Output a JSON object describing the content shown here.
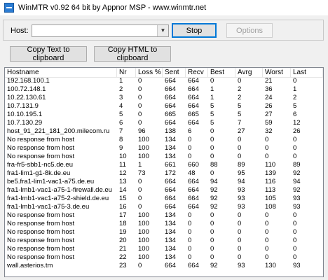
{
  "window": {
    "title": "WinMTR v0.92 64 bit by Appnor MSP - www.winmtr.net"
  },
  "toolbar": {
    "host_label": "Host:",
    "host_value": "",
    "stop_label": "Stop",
    "options_label": "Options",
    "copy_text_label": "Copy Text to clipboard",
    "copy_html_label": "Copy HTML to clipboard"
  },
  "table": {
    "columns": [
      "Hostname",
      "Nr",
      "Loss %",
      "Sent",
      "Recv",
      "Best",
      "Avrg",
      "Worst",
      "Last"
    ],
    "rows": [
      [
        "192.168.100.1",
        "1",
        "0",
        "664",
        "664",
        "0",
        "0",
        "21",
        "0"
      ],
      [
        "100.72.148.1",
        "2",
        "0",
        "664",
        "664",
        "1",
        "2",
        "36",
        "1"
      ],
      [
        "10.22.130.61",
        "3",
        "0",
        "664",
        "664",
        "1",
        "2",
        "24",
        "2"
      ],
      [
        "10.7.131.9",
        "4",
        "0",
        "664",
        "664",
        "5",
        "5",
        "26",
        "5"
      ],
      [
        "10.10.195.1",
        "5",
        "0",
        "665",
        "665",
        "5",
        "5",
        "27",
        "6"
      ],
      [
        "10.7.130.29",
        "6",
        "0",
        "664",
        "664",
        "5",
        "7",
        "59",
        "12"
      ],
      [
        "host_91_221_181_200.milecom.ru",
        "7",
        "96",
        "138",
        "6",
        "0",
        "27",
        "32",
        "26"
      ],
      [
        "No response from host",
        "8",
        "100",
        "134",
        "0",
        "0",
        "0",
        "0",
        "0"
      ],
      [
        "No response from host",
        "9",
        "100",
        "134",
        "0",
        "0",
        "0",
        "0",
        "0"
      ],
      [
        "No response from host",
        "10",
        "100",
        "134",
        "0",
        "0",
        "0",
        "0",
        "0"
      ],
      [
        "fra-fr5-sbb1-nc5.de.eu",
        "11",
        "1",
        "661",
        "660",
        "88",
        "89",
        "110",
        "89"
      ],
      [
        "fra1-lim1-g1-8k.de.eu",
        "12",
        "73",
        "172",
        "48",
        "0",
        "95",
        "139",
        "92"
      ],
      [
        "be5.fra1-lim1-vac1-a75.de.eu",
        "13",
        "0",
        "664",
        "664",
        "94",
        "94",
        "116",
        "94"
      ],
      [
        "fra1-lmb1-vac1-a75-1-firewall.de.eu",
        "14",
        "0",
        "664",
        "664",
        "92",
        "93",
        "113",
        "92"
      ],
      [
        "fra1-lmb1-vac1-a75-2-shield.de.eu",
        "15",
        "0",
        "664",
        "664",
        "92",
        "93",
        "105",
        "93"
      ],
      [
        "fra1-lmb1-vac1-a75-3.de.eu",
        "16",
        "0",
        "664",
        "664",
        "92",
        "93",
        "108",
        "93"
      ],
      [
        "No response from host",
        "17",
        "100",
        "134",
        "0",
        "0",
        "0",
        "0",
        "0"
      ],
      [
        "No response from host",
        "18",
        "100",
        "134",
        "0",
        "0",
        "0",
        "0",
        "0"
      ],
      [
        "No response from host",
        "19",
        "100",
        "134",
        "0",
        "0",
        "0",
        "0",
        "0"
      ],
      [
        "No response from host",
        "20",
        "100",
        "134",
        "0",
        "0",
        "0",
        "0",
        "0"
      ],
      [
        "No response from host",
        "21",
        "100",
        "134",
        "0",
        "0",
        "0",
        "0",
        "0"
      ],
      [
        "No response from host",
        "22",
        "100",
        "134",
        "0",
        "0",
        "0",
        "0",
        "0"
      ],
      [
        "wall.asterios.tm",
        "23",
        "0",
        "664",
        "664",
        "92",
        "93",
        "130",
        "93"
      ]
    ]
  }
}
